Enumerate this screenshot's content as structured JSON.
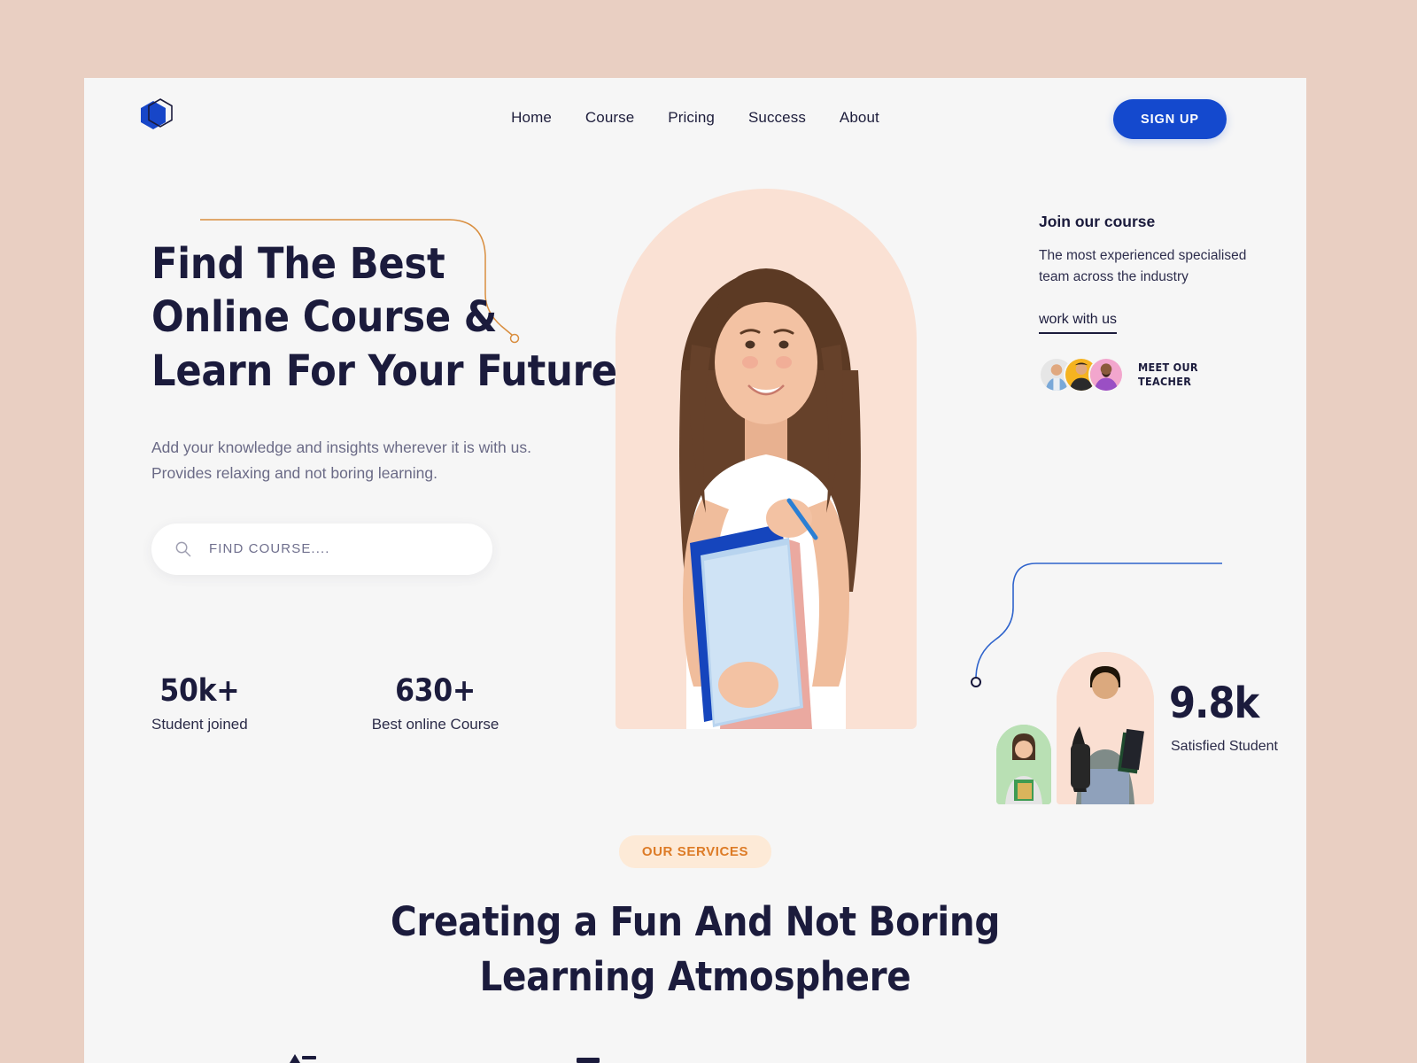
{
  "brand": {
    "logo_icon": "hexagon-logo-icon",
    "accent_blue": "#1449ce",
    "accent_orange": "#dd7b26",
    "dark": "#1b1b3c"
  },
  "nav": {
    "items": [
      {
        "label": "Home"
      },
      {
        "label": "Course"
      },
      {
        "label": "Pricing"
      },
      {
        "label": "Success"
      },
      {
        "label": "About"
      }
    ],
    "signup_label": "SIGN UP"
  },
  "hero": {
    "heading_line1": "Find The Best",
    "heading_line2": "Online Course &",
    "heading_line3": "Learn For Your Future",
    "subtitle": "Add your knowledge and insights wherever it is with us. Provides relaxing and not boring learning.",
    "search_placeholder": "FIND COURSE....",
    "search_value": "",
    "search_icon": "search-icon",
    "stats": [
      {
        "number": "50k+",
        "label": "Student joined"
      },
      {
        "number": "630+",
        "label": "Best online Course"
      }
    ]
  },
  "right_panel": {
    "title": "Join our course",
    "description": "The most experienced specialised team across the industry",
    "link_label": "work with us",
    "meet_teacher_line1": "MEET OUR",
    "meet_teacher_line2": "TEACHER",
    "avatars": [
      {
        "name": "teacher-avatar-1",
        "bg": "#e6e6e6"
      },
      {
        "name": "teacher-avatar-2",
        "bg": "#f5b320"
      },
      {
        "name": "teacher-avatar-3",
        "bg": "#f2a6cd"
      }
    ]
  },
  "satisfied": {
    "number": "9.8k",
    "label": "Satisfied Student"
  },
  "services": {
    "badge": "OUR SERVICES",
    "heading_line1": "Creating a Fun And Not Boring",
    "heading_line2": "Learning Atmosphere"
  }
}
